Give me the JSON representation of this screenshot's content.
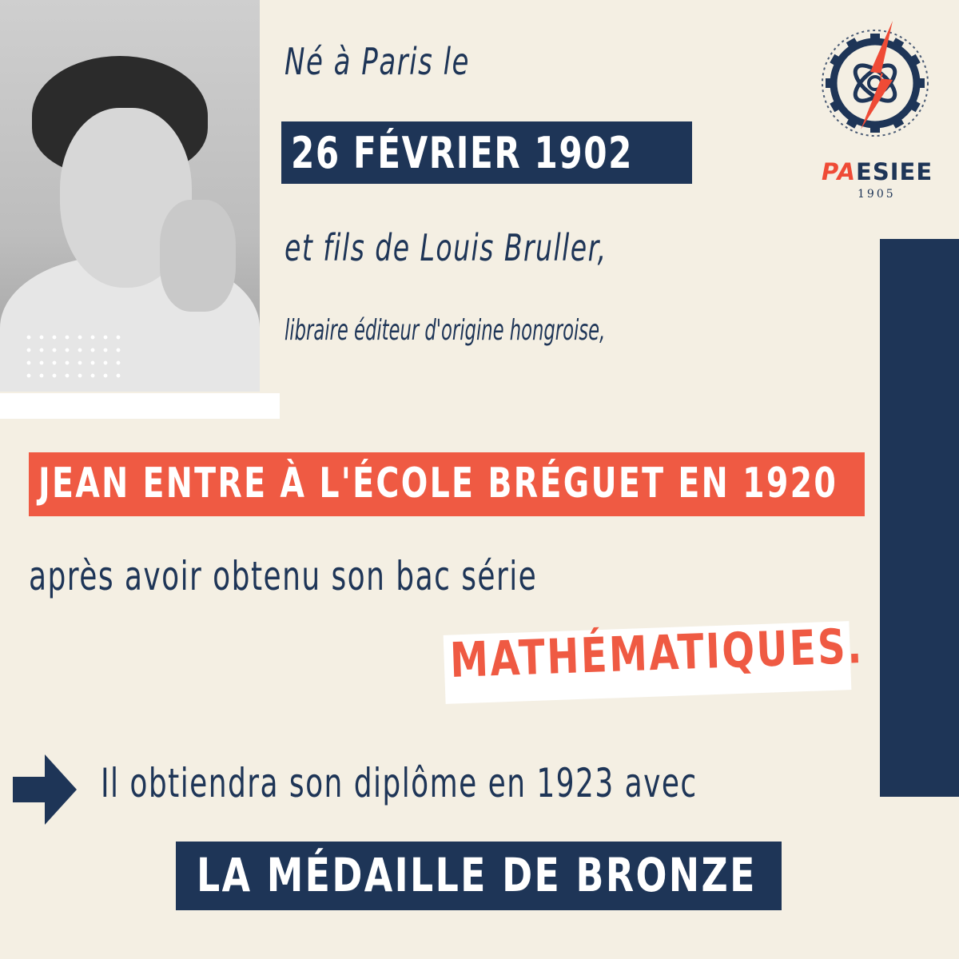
{
  "header": {
    "line1": "Né à Paris le",
    "date": "26 FÉVRIER 1902",
    "line3": "et fils de Louis Bruller,",
    "line4": "libraire éditeur d'origine hongroise,"
  },
  "body": {
    "highlight": "JEAN ENTRE À L'ÉCOLE BRÉGUET EN 1920",
    "line6": "après avoir obtenu son bac série",
    "subject": "MATHÉMATIQUES.",
    "line8": "Il obtiendra son diplôme en 1923 avec",
    "award": "LA MÉDAILLE DE BRONZE"
  },
  "logo": {
    "brand_prefix": "PA",
    "brand_name": "ESIEE",
    "year": "1905"
  },
  "colors": {
    "navy": "#1e3557",
    "red": "#ef5a43",
    "cream": "#f4efe3"
  },
  "icons": {
    "arrow": "arrow-right-icon",
    "logo": "gear-atom-lightning-logo"
  }
}
